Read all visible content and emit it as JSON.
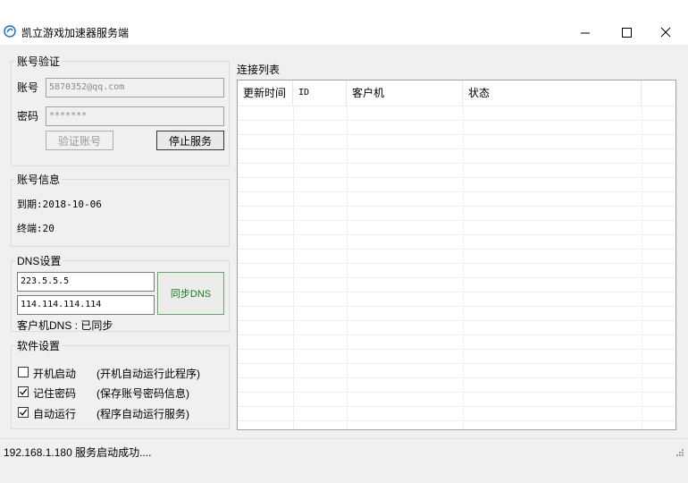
{
  "window": {
    "title": "凯立游戏加速器服务端"
  },
  "account_verify": {
    "legend": "账号验证",
    "account_label": "账号",
    "account_value": "5870352@qq.com",
    "password_label": "密码",
    "password_value": "*******",
    "verify_button": "验证账号",
    "stop_button": "停止服务"
  },
  "account_info": {
    "legend": "账号信息",
    "expiry": "到期:2018-10-06",
    "terminals": "终端:20"
  },
  "dns": {
    "legend": "DNS设置",
    "dns1": "223.5.5.5",
    "dns2": "114.114.114.114",
    "sync_button": "同步DNS",
    "status": "客户机DNS : 已同步"
  },
  "software": {
    "legend": "软件设置",
    "options": [
      {
        "label": "开机启动",
        "desc": "(开机自动运行此程序)",
        "checked": false
      },
      {
        "label": "记住密码",
        "desc": "(保存账号密码信息)",
        "checked": true
      },
      {
        "label": "自动运行",
        "desc": "(程序自动运行服务)",
        "checked": true
      }
    ]
  },
  "connections": {
    "title": "连接列表",
    "columns": [
      "更新时间",
      "ID",
      "客户机",
      "状态"
    ]
  },
  "statusbar": {
    "text": "192.168.1.180 服务启动成功...."
  },
  "icons": {
    "app": "accelerator-app-icon",
    "check": "checkmark-icon",
    "grip": "resize-grip-icon"
  }
}
